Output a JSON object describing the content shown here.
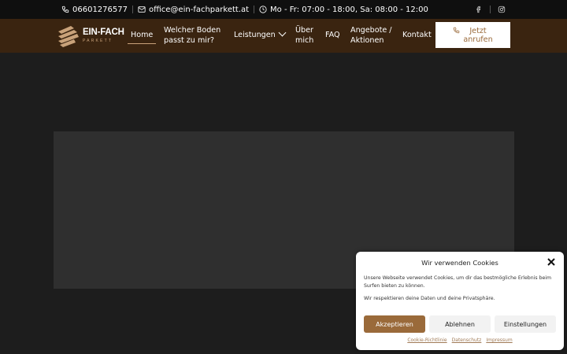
{
  "topbar": {
    "phone": "06601276577",
    "email": "office@ein-fachparkett.at",
    "hours": "Mo - Fr: 07:00 - 18:00, Sa: 08:00 - 12:00",
    "social_icons": [
      "facebook-icon",
      "instagram-icon"
    ]
  },
  "logo": {
    "name": "EIN-FACH",
    "sub": "PARKETT"
  },
  "nav": {
    "home": "Home",
    "floor_line1": "Welcher Boden",
    "floor_line2": "passt zu mir?",
    "services": "Leistungen",
    "about_line1": "Über",
    "about_line2": "mich",
    "faq": "FAQ",
    "offers_line1": "Angebote /",
    "offers_line2": "Aktionen",
    "contact": "Kontakt",
    "call_line1": "Jetzt",
    "call_line2": "anrufen"
  },
  "cookie": {
    "title": "Wir verwenden Cookies",
    "text1": "Unsere Webseite verwendet Cookies, um dir das bestmögliche Erlebnis beim Surfen bieten zu können.",
    "text2": "Wir respektieren deine Daten und deine Privatsphäre.",
    "accept": "Akzeptieren",
    "decline": "Ablehnen",
    "settings": "Einstellungen",
    "link_policy": "Cookie-Richtlinie",
    "link_privacy": "Datenschutz",
    "link_imprint": "Impressum"
  },
  "colors": {
    "topbar_bg": "#0f0f0f",
    "header_bg": "#3a2410",
    "accent": "#9a6a3a",
    "page_bg": "#1d1d1d"
  }
}
